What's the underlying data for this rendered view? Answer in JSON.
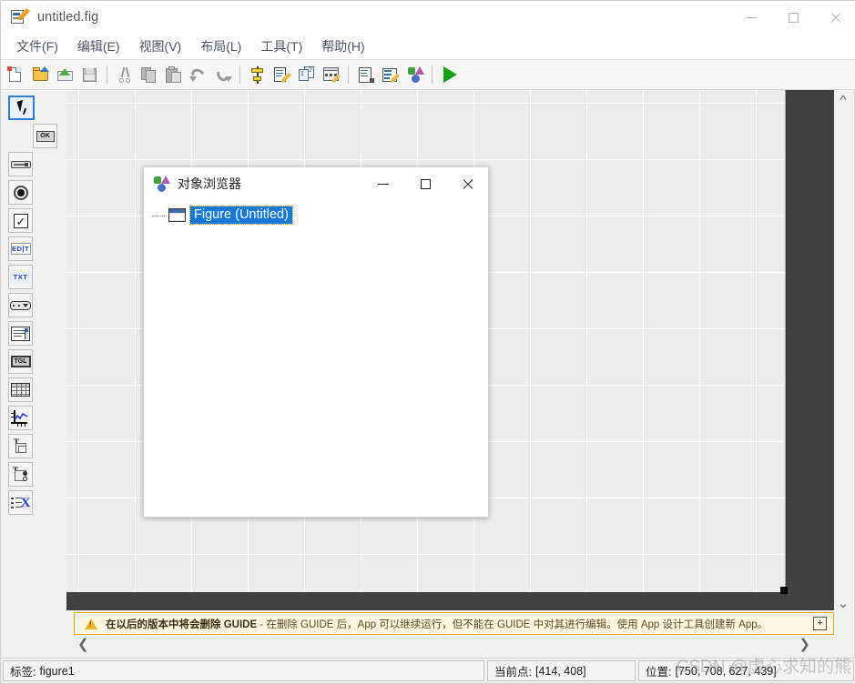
{
  "window": {
    "title": "untitled.fig",
    "icon": "fig-file-icon",
    "controls": {
      "minimize": "minimize-icon",
      "maximize": "maximize-icon",
      "close": "close-icon"
    }
  },
  "menubar": {
    "items": [
      {
        "label": "文件(F)",
        "name": "menu-file"
      },
      {
        "label": "编辑(E)",
        "name": "menu-edit"
      },
      {
        "label": "视图(V)",
        "name": "menu-view"
      },
      {
        "label": "布局(L)",
        "name": "menu-layout"
      },
      {
        "label": "工具(T)",
        "name": "menu-tools"
      },
      {
        "label": "帮助(H)",
        "name": "menu-help"
      }
    ]
  },
  "toolbar": {
    "buttons": [
      {
        "icon": "new-figure-icon",
        "name": "toolbar-new"
      },
      {
        "icon": "open-folder-icon",
        "name": "toolbar-open"
      },
      {
        "icon": "save-as-icon",
        "name": "toolbar-save-as"
      },
      {
        "icon": "save-icon",
        "name": "toolbar-save"
      },
      {
        "icon": "cut-scissors-icon",
        "name": "toolbar-cut"
      },
      {
        "icon": "copy-icon",
        "name": "toolbar-copy"
      },
      {
        "icon": "paste-icon",
        "name": "toolbar-paste"
      },
      {
        "icon": "undo-icon",
        "name": "toolbar-undo"
      },
      {
        "icon": "redo-icon",
        "name": "toolbar-redo"
      },
      {
        "icon": "align-objects-icon",
        "name": "toolbar-align-objects"
      },
      {
        "icon": "menu-editor-icon",
        "name": "toolbar-menu-editor"
      },
      {
        "icon": "tab-order-editor-icon",
        "name": "toolbar-tab-order-editor"
      },
      {
        "icon": "toolbar-editor-icon",
        "name": "toolbar-toolbar-editor"
      },
      {
        "icon": "m-file-editor-icon",
        "name": "toolbar-m-file-editor"
      },
      {
        "icon": "property-inspector-icon",
        "name": "toolbar-property-inspector"
      },
      {
        "icon": "object-browser-icon",
        "name": "toolbar-object-browser"
      },
      {
        "icon": "run-icon",
        "name": "toolbar-run"
      }
    ]
  },
  "palette": {
    "items": [
      {
        "name": "tool-select-cursor",
        "icon": "cursor-arrow-icon",
        "selected": true
      },
      {
        "name": "tool-push-button",
        "icon": "push-button-icon",
        "glyph": "OK"
      },
      {
        "name": "tool-slider",
        "icon": "slider-icon"
      },
      {
        "name": "tool-radio-button",
        "icon": "radio-button-icon"
      },
      {
        "name": "tool-checkbox",
        "icon": "checkbox-icon"
      },
      {
        "name": "tool-edit-text",
        "icon": "edit-text-icon",
        "glyph": "EDIT"
      },
      {
        "name": "tool-static-text",
        "icon": "static-text-icon",
        "glyph": "TXT"
      },
      {
        "name": "tool-popup-menu",
        "icon": "popup-menu-icon"
      },
      {
        "name": "tool-listbox",
        "icon": "listbox-icon"
      },
      {
        "name": "tool-toggle-button",
        "icon": "toggle-button-icon",
        "glyph": "TGL"
      },
      {
        "name": "tool-table",
        "icon": "table-icon"
      },
      {
        "name": "tool-axes",
        "icon": "axes-icon"
      },
      {
        "name": "tool-panel",
        "icon": "panel-icon"
      },
      {
        "name": "tool-button-group",
        "icon": "button-group-icon"
      },
      {
        "name": "tool-activex-control",
        "icon": "activex-control-icon"
      }
    ]
  },
  "canvas": {
    "grid_color": "#ffffff",
    "cell_color": "#ececec",
    "outside_color": "#404040",
    "resize_handle": "resize-handle"
  },
  "scrollbars": {
    "vertical": {
      "up": "chevron-up-icon",
      "down": "chevron-down-icon"
    },
    "horizontal": {
      "left": "chevron-left-icon",
      "right": "chevron-right-icon"
    }
  },
  "banner": {
    "icon": "warning-triangle-icon",
    "bold_text": "在以后的版本中将会删除 GUIDE",
    "rest_text": " - 在删除 GUIDE 后，App 可以继续运行，但不能在 GUIDE 中对其进行编辑。使用 App 设计工具创建新 App。",
    "expand_label": "+",
    "accent_color": "#e3a81c",
    "background_color": "#fdf6e3"
  },
  "statusbar": {
    "tag_label": "标签:",
    "tag_value": "figure1",
    "point_label": "当前点:",
    "point_value": "[414, 408]",
    "position_label": "位置:",
    "position_value": "[750, 708, 627, 439]",
    "watermark": "CSDN @虚心求知的熊"
  },
  "object_browser": {
    "title": "对象浏览器",
    "icon": "object-browser-icon",
    "controls": {
      "minimize": "minimize-icon",
      "maximize": "maximize-icon",
      "close": "close-icon"
    },
    "tree": [
      {
        "label": "Figure (Untitled)",
        "icon": "figure-node-icon",
        "selected": true,
        "selection_color": "#1579d6"
      }
    ]
  }
}
